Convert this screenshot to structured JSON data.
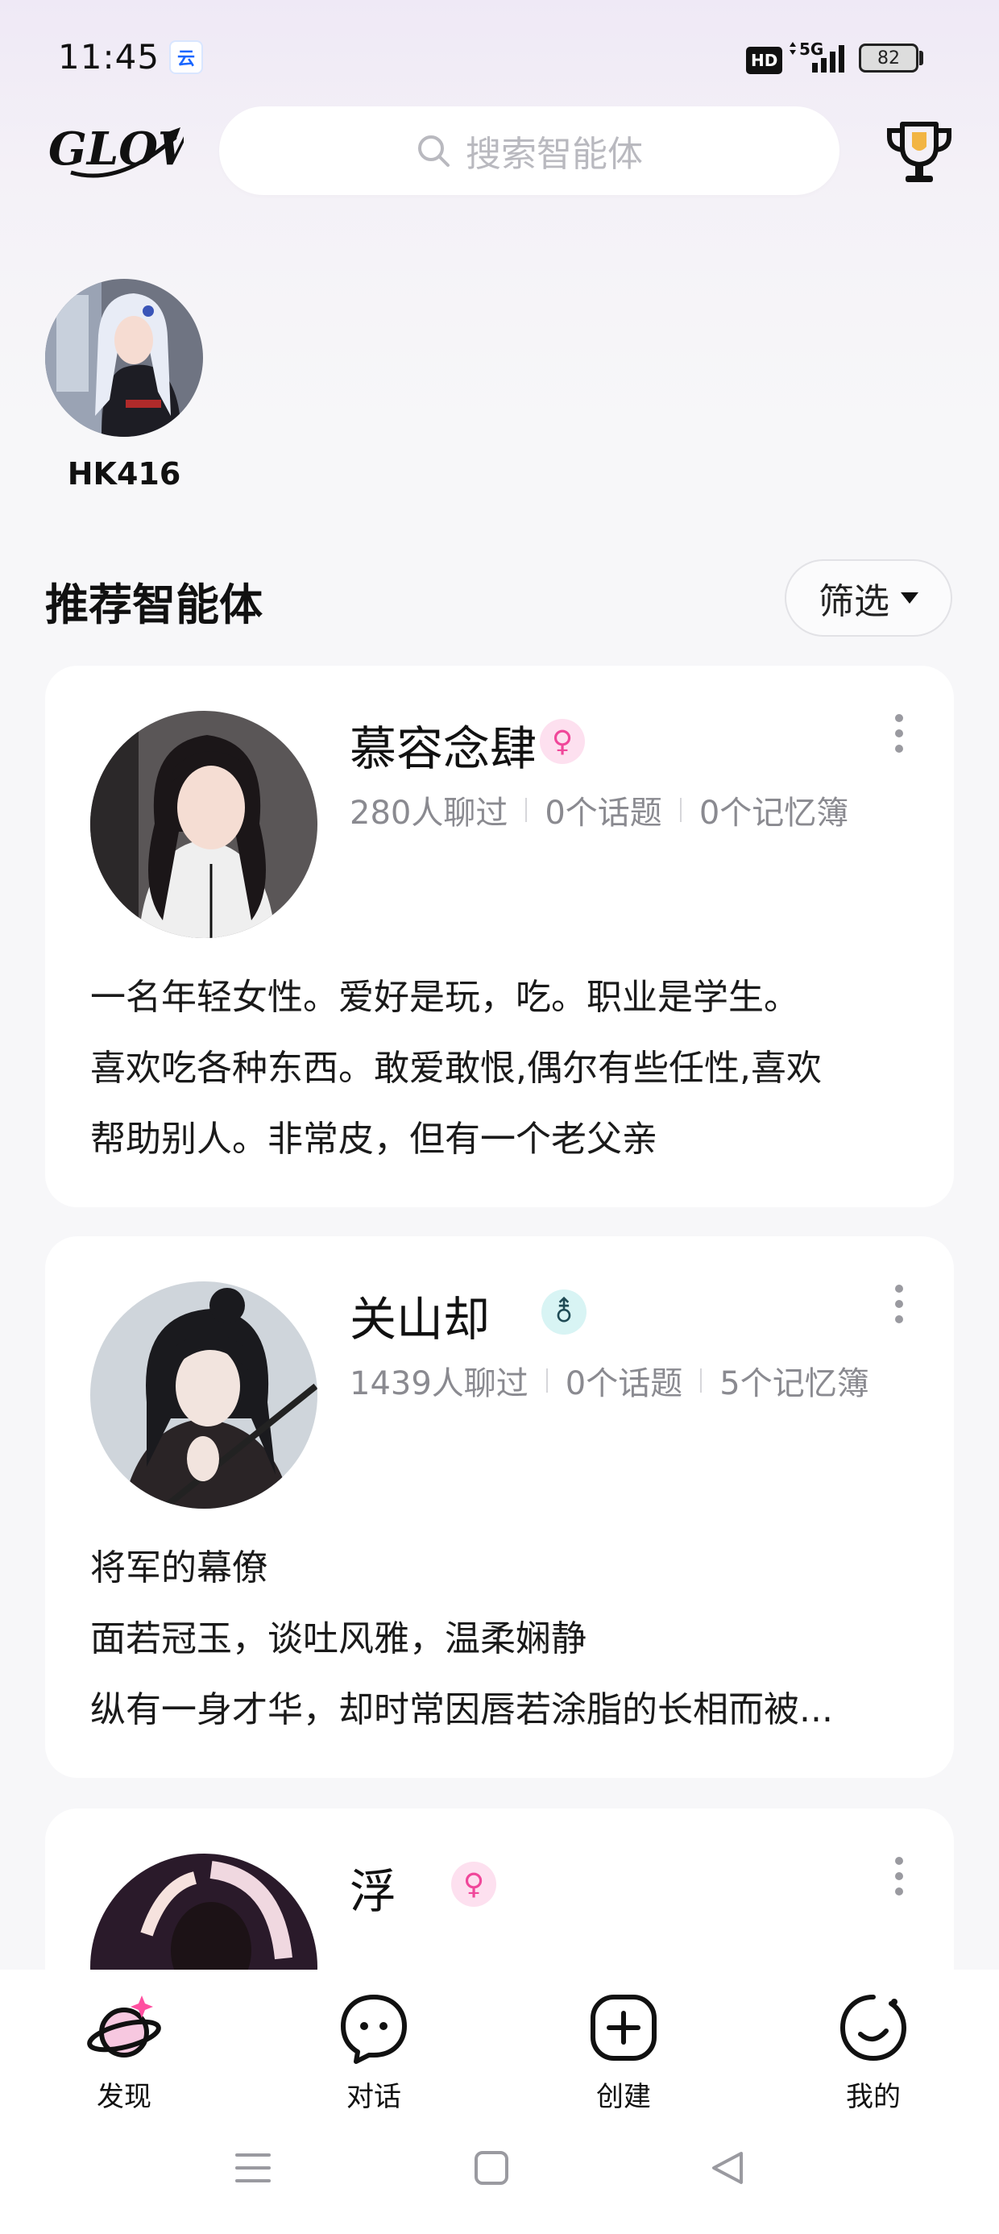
{
  "status_bar": {
    "time": "11:45",
    "app_icon_glyph": "云",
    "hd": "HD",
    "network": "5G",
    "battery": "82"
  },
  "header": {
    "logo_text": "GLOW",
    "search_placeholder": "搜索智能体",
    "trophy_icon": "trophy-icon"
  },
  "recent": [
    {
      "name": "HK416"
    }
  ],
  "section": {
    "title": "推荐智能体",
    "filter_label": "筛选"
  },
  "cards": [
    {
      "name": "慕容念肆",
      "gender": "♀",
      "stats": [
        "280人聊过",
        "0个话题",
        "0个记忆簿"
      ],
      "description": [
        "一名年轻女性。爱好是玩，吃。职业是学生。",
        "喜欢吃各种东西。敢爱敢恨,偶尔有些任性,喜欢",
        "帮助别人。非常皮，但有一个老父亲"
      ]
    },
    {
      "name": "关山却",
      "gender": "⚨",
      "stats": [
        "1439人聊过",
        "0个话题",
        "5个记忆簿"
      ],
      "description": [
        "将军的幕僚",
        "面若冠玉，谈吐风雅，温柔娴静",
        "纵有一身才华，却时常因唇若涂脂的长相而被..."
      ]
    },
    {
      "name": "浮",
      "gender": "♀",
      "stats": [],
      "description": []
    }
  ],
  "bottom_nav": [
    {
      "label": "发现",
      "icon": "planet-icon"
    },
    {
      "label": "对话",
      "icon": "chat-bubble-icon"
    },
    {
      "label": "创建",
      "icon": "plus-square-icon"
    },
    {
      "label": "我的",
      "icon": "smile-icon"
    }
  ],
  "colors": {
    "accent_pink": "#f0479a",
    "text_gray": "#8a8a90",
    "card_bg": "#ffffff"
  }
}
